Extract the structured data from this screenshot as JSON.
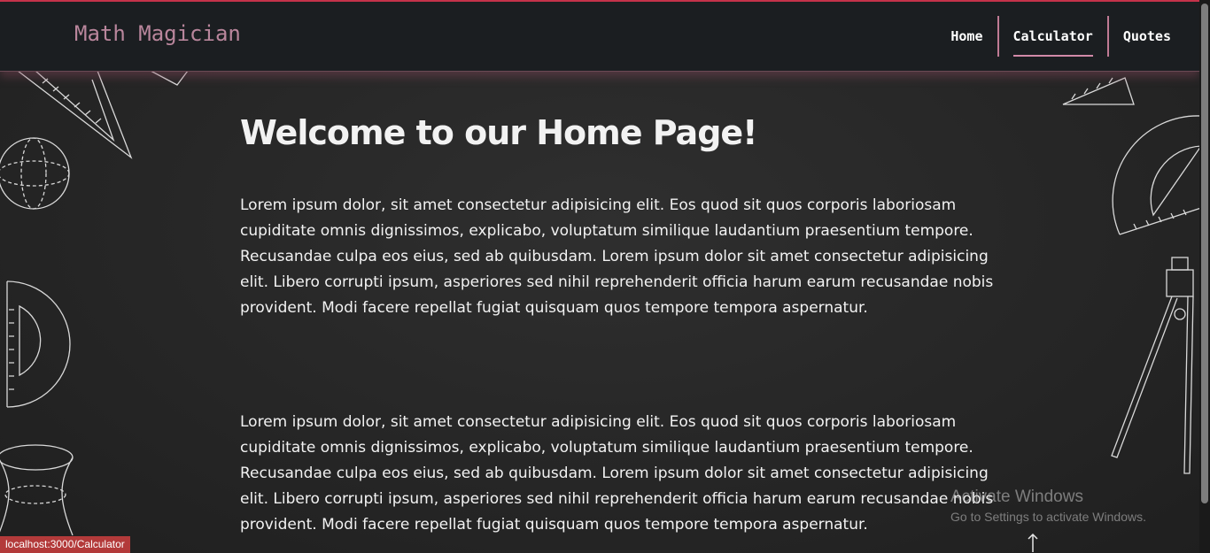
{
  "app": {
    "brand": "Math Magician"
  },
  "nav": {
    "items": [
      {
        "label": "Home",
        "active": false
      },
      {
        "label": "Calculator",
        "active": true
      },
      {
        "label": "Quotes",
        "active": false
      }
    ],
    "accent_color": "#d28aa8"
  },
  "main": {
    "heading": "Welcome to our Home Page!",
    "paragraphs": [
      "Lorem ipsum dolor, sit amet consectetur adipisicing elit. Eos quod sit quos corporis laboriosam cupiditate omnis dignissimos, explicabo, voluptatum similique laudantium praesentium tempore. Recusandae culpa eos eius, sed ab quibusdam. Lorem ipsum dolor sit amet consectetur adipisicing elit. Libero corrupti ipsum, asperiores sed nihil reprehenderit officia harum earum recusandae nobis provident. Modi facere repellat fugiat quisquam quos tempore tempora aspernatur.",
      "Lorem ipsum dolor, sit amet consectetur adipisicing elit. Eos quod sit quos corporis laboriosam cupiditate omnis dignissimos, explicabo, voluptatum similique laudantium praesentium tempore. Recusandae culpa eos eius, sed ab quibusdam. Lorem ipsum dolor sit amet consectetur adipisicing elit. Libero corrupti ipsum, asperiores sed nihil reprehenderit officia harum earum recusandae nobis provident. Modi facere repellat fugiat quisquam quos tempore tempora aspernatur."
    ]
  },
  "status_bar": {
    "link_preview": "localhost:3000/Calculator"
  },
  "os_watermark": {
    "title": "Activate Windows",
    "subtitle": "Go to Settings to activate Windows."
  },
  "decorations": [
    "set-square-icon",
    "globe-icon",
    "protractor-icon",
    "cylinder-icon",
    "compass-icon"
  ]
}
